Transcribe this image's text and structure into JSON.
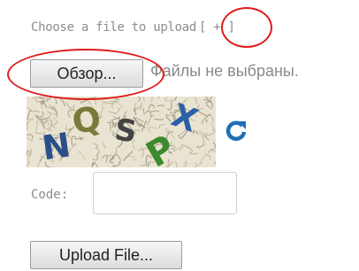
{
  "upload_form": {
    "choose_label": "Choose a file to upload",
    "add_link": "[ + ]",
    "browse_button": "Обзор...",
    "no_file_text": "Файлы не выбраны.",
    "captcha": {
      "characters": [
        "N",
        "Q",
        "S",
        "P",
        "X"
      ],
      "character_colors": [
        "#2b4f8a",
        "#7a7a3a",
        "#444444",
        "#3c8a2e",
        "#2b5fa8"
      ],
      "refresh_icon": "refresh-icon",
      "refresh_color": "#1f6fb8"
    },
    "code_label": "Code:",
    "code_value": "",
    "upload_button": "Upload File..."
  },
  "annotations": {
    "color": "#e01b1b"
  }
}
